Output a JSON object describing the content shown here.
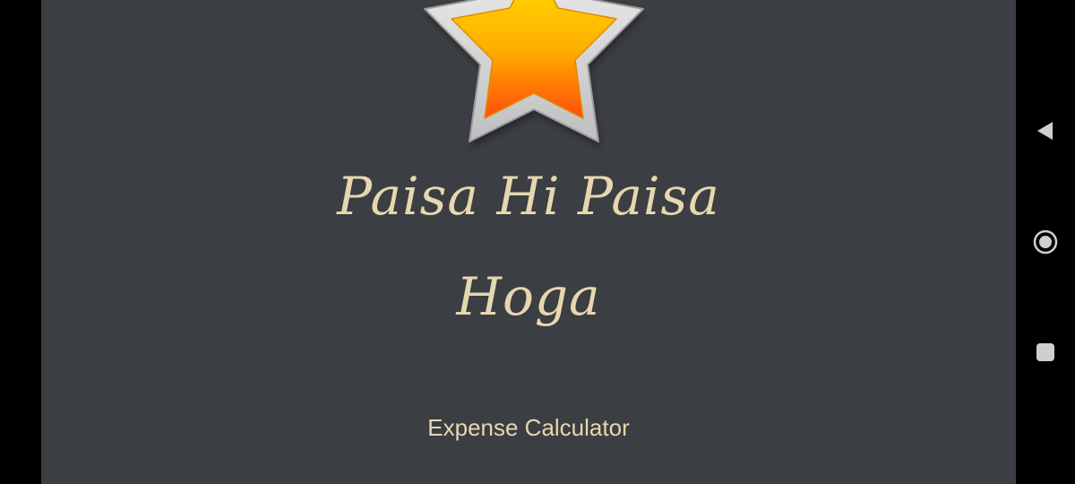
{
  "app": {
    "title_line_1": "Paisa Hi Paisa",
    "title_line_2": "Hoga",
    "subtitle": "Expense Calculator",
    "logo_icon": "star-icon"
  },
  "nav_bar": {
    "buttons": [
      {
        "icon": "back-triangle-icon"
      },
      {
        "icon": "home-circle-icon"
      },
      {
        "icon": "recents-square-icon"
      }
    ]
  },
  "colors": {
    "app_background": "#3b3e42",
    "text_accent": "#e6d7b0",
    "bezel": "#000000",
    "star_fill_top": "#ffd200",
    "star_fill_bottom": "#ff5a0a",
    "star_outline": "#d9d9d9",
    "nav_icon": "#cfcfcf"
  }
}
